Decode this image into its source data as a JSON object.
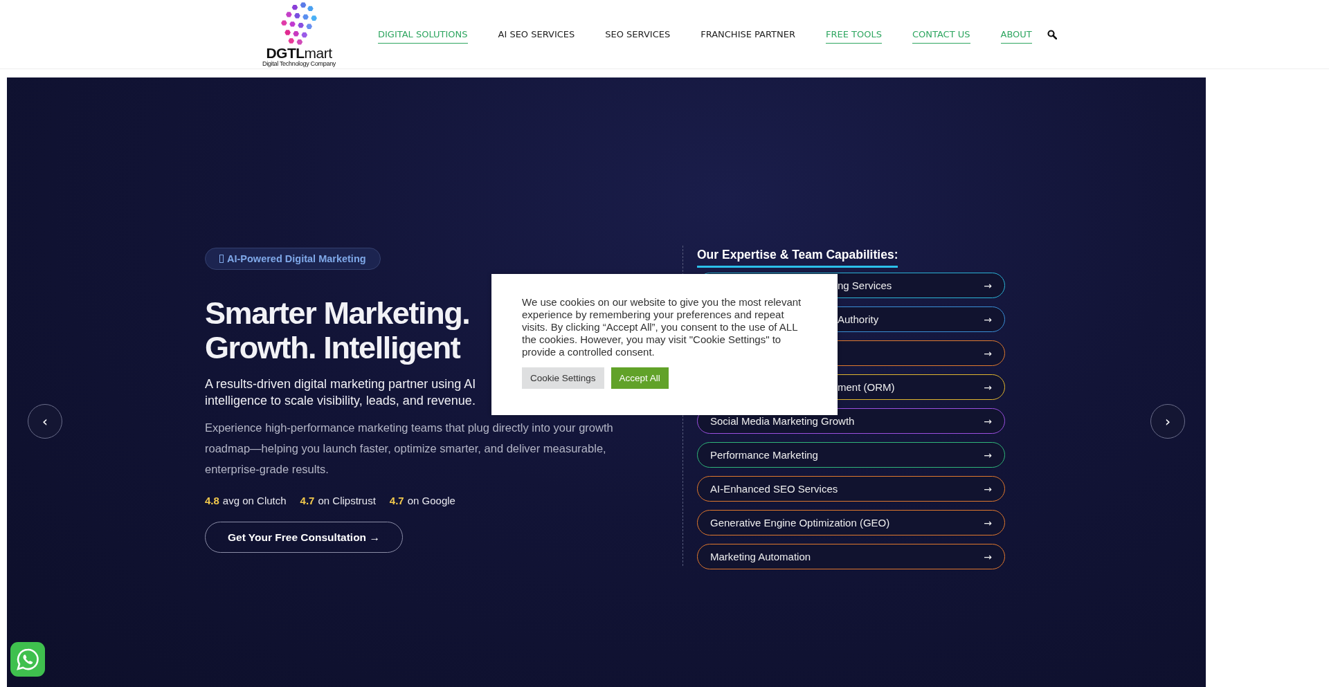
{
  "logo": {
    "name": "**DGTL**mart",
    "tagline": "Digital Technology Company"
  },
  "nav": [
    {
      "label": "DIGITAL SOLUTIONS",
      "active": true
    },
    {
      "label": "AI SEO SERVICES",
      "active": false
    },
    {
      "label": "SEO SERVICES",
      "active": false
    },
    {
      "label": "FRANCHISE PARTNER",
      "active": false
    },
    {
      "label": "FREE TOOLS",
      "active": true
    },
    {
      "label": "CONTACT US",
      "active": true
    },
    {
      "label": "ABOUT",
      "active": true
    }
  ],
  "hero": {
    "badge": "AI-Powered Digital Marketing",
    "title_lines": [
      "Smarter Marketing.",
      "Growth. Intelligent"
    ],
    "subtitle_lines": [
      "A results-driven digital marketing partner using AI",
      "intelligence to scale visibility, leads, and revenue."
    ],
    "paragraph": "Experience high-performance marketing teams that plug directly into your growth roadmap—helping you launch faster, optimize smarter, and deliver measurable, enterprise-grade results.",
    "ratings": [
      {
        "score": "4.8",
        "label": "avg on Clutch"
      },
      {
        "score": "4.7",
        "label": "on Clipstrust"
      },
      {
        "score": "4.7",
        "label": "on Google"
      }
    ],
    "cta": "Get Your Free Consultation →"
  },
  "expertise": {
    "heading": "Our Expertise & Team Capabilities:",
    "items": [
      {
        "kind": "partly_hidden",
        "label": "ng Services",
        "arrow": "→",
        "color": "#2bb3d6"
      },
      {
        "kind": "partly_hidden",
        "label": "Authority",
        "arrow": "→",
        "color": "#3a8fd8"
      },
      {
        "kind": "partly_hidden",
        "arrow": "→",
        "color": "#e07a2e"
      },
      {
        "kind": "partly_hidden",
        "label": "ment (ORM)",
        "arrow": "→",
        "color": "#e0b52e"
      },
      {
        "kind": "full",
        "label": "Social Media Marketing Growth",
        "arrow": "→",
        "color": "#9a4fe0"
      },
      {
        "kind": "full",
        "label": "Performance Marketing",
        "arrow": "→",
        "color": "#2fb67a"
      },
      {
        "kind": "full",
        "label": "AI-Enhanced SEO Services",
        "arrow": "→",
        "color": "#e0782e"
      },
      {
        "kind": "full",
        "label": "Generative Engine Optimization (GEO)",
        "arrow": "→",
        "color": "#e0782e"
      },
      {
        "kind": "full",
        "label": "Marketing Automation",
        "arrow": "→",
        "color": "#e0782e"
      }
    ]
  },
  "slider": {
    "prev": "‹",
    "next": "›"
  },
  "cookie": {
    "text": "We use cookies on our website to give you the most relevant experience by remembering your preferences and repeat visits. By clicking “Accept All”, you consent to the use of ALL the cookies. However, you may visit \"Cookie Settings\" to provide a controlled consent.",
    "settings": "Cookie Settings",
    "accept": "Accept All"
  }
}
